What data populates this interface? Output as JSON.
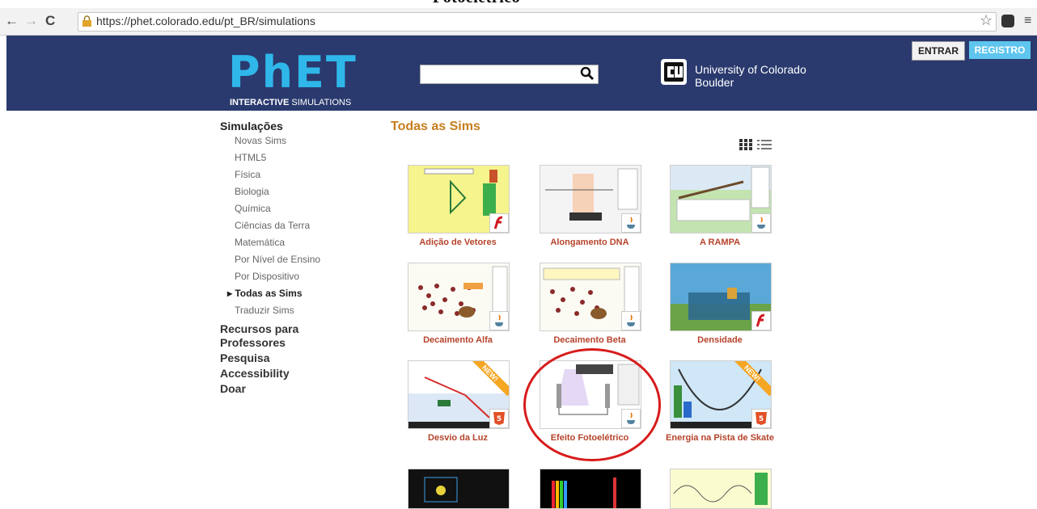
{
  "caption": "Fotoelétrico",
  "browser": {
    "back": "←",
    "forward": "→",
    "reload": "C",
    "url": "https://phet.colorado.edu/pt_BR/simulations",
    "star": "☆",
    "menu": "≡"
  },
  "header": {
    "logo_text": "PhET",
    "logo_sub_bold": "INTERACTIVE",
    "logo_sub": " SIMULATIONS",
    "search_placeholder": "",
    "university_line1": "University of Colorado",
    "university_line2": "Boulder",
    "login": "ENTRAR",
    "register": "REGISTRO"
  },
  "sidebar": {
    "title": "Simulações",
    "items": [
      {
        "label": "Novas Sims"
      },
      {
        "label": "HTML5"
      },
      {
        "label": "Física"
      },
      {
        "label": "Biologia"
      },
      {
        "label": "Química"
      },
      {
        "label": "Ciências da Terra"
      },
      {
        "label": "Matemática"
      },
      {
        "label": "Por Nível de Ensino"
      },
      {
        "label": "Por Dispositivo"
      },
      {
        "label": "▸ Todas as Sims"
      },
      {
        "label": "Traduzir Sims"
      }
    ],
    "sections": [
      {
        "label": "Recursos para Professores"
      },
      {
        "label": "Pesquisa"
      },
      {
        "label": "Accessibility"
      },
      {
        "label": "Doar"
      }
    ]
  },
  "content": {
    "title": "Todas as Sims",
    "tiles": [
      {
        "label": "Adição de Vetores",
        "badge": "flash-icon"
      },
      {
        "label": "Alongamento DNA",
        "badge": "java-icon"
      },
      {
        "label": "A RAMPA",
        "badge": "java-icon"
      },
      {
        "label": "Decaimento Alfa",
        "badge": "java-icon"
      },
      {
        "label": "Decaimento Beta",
        "badge": "java-icon"
      },
      {
        "label": "Densidade",
        "badge": "flash-icon"
      },
      {
        "label": "Desvio da Luz",
        "badge": "html5-icon",
        "new": "NEW!"
      },
      {
        "label": "Efeito Fotoelétrico",
        "badge": "java-icon"
      },
      {
        "label": "Energia na Pista de Skate",
        "badge": "html5-icon",
        "new": "NEW!"
      }
    ]
  },
  "colors": {
    "header_bg": "#2a3a6e",
    "logo": "#2fb7ea",
    "title_orange": "#c77d1c",
    "tile_label": "#b5432b",
    "annotation_circle": "#d81b1b"
  }
}
